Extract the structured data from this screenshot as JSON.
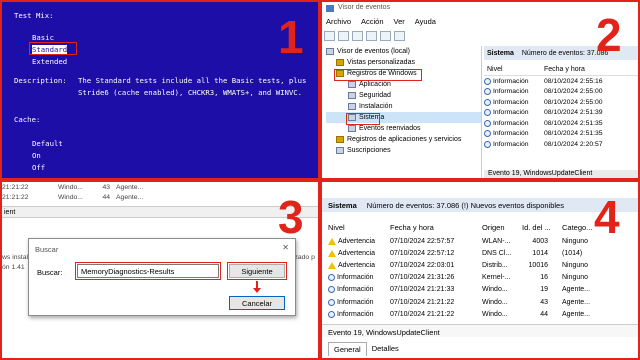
{
  "panel1": {
    "number": "1",
    "test_mix_label": "Test Mix:",
    "options": [
      "Basic",
      "Standard",
      "Extended"
    ],
    "description_label": "Description:",
    "description_line1": "The Standard tests include all the Basic tests, plus",
    "description_line2": "Stride6 (cache enabled), CHCKR3, WMATS+, and WINVC.",
    "cache_label": "Cache:",
    "cache_options": [
      "Default",
      "On",
      "Off"
    ]
  },
  "panel2": {
    "number": "2",
    "window_title": "Visor de eventos",
    "menu": [
      "Archivo",
      "Acción",
      "Ver",
      "Ayuda"
    ],
    "tree": {
      "root": "Visor de eventos (local)",
      "custom_views": "Vistas personalizadas",
      "windows_logs": "Registros de Windows",
      "logs": [
        "Aplicación",
        "Seguridad",
        "Instalación",
        "Sistema",
        "Eventos reenviados"
      ],
      "apps_services": "Registros de aplicaciones y servicios",
      "subscriptions": "Suscripciones"
    },
    "list_header": {
      "name": "Sistema",
      "count": "Número de eventos: 37.086"
    },
    "columns": [
      "Nivel",
      "Fecha y hora"
    ],
    "rows": [
      {
        "level": "Información",
        "date": "08/10/2024 2:55:16"
      },
      {
        "level": "Información",
        "date": "08/10/2024 2:55:00"
      },
      {
        "level": "Información",
        "date": "08/10/2024 2:55:00"
      },
      {
        "level": "Información",
        "date": "08/10/2024 2:51:39"
      },
      {
        "level": "Información",
        "date": "08/10/2024 2:51:35"
      },
      {
        "level": "Información",
        "date": "08/10/2024 2:51:35"
      },
      {
        "level": "Información",
        "date": "08/10/2024 2:20:57"
      }
    ],
    "footer": "Evento 19, WindowsUpdateClient"
  },
  "panel3": {
    "number": "3",
    "bg_rows": [
      {
        "time": "21:21:22",
        "source": "Windo...",
        "id": "43",
        "cat": "Agente..."
      },
      {
        "time": "21:21:22",
        "source": "Windo...",
        "id": "44",
        "cat": "Agente..."
      }
    ],
    "bg_label": "ient",
    "bg_text1": "ws instal",
    "bg_text2": "ón 1.41",
    "bg_right1": "tualizado p",
    "dialog_title": "Buscar",
    "search_label": "Buscar:",
    "search_value": "MemoryDiagnostics-Results",
    "next_button": "Siguiente",
    "cancel_button": "Cancelar",
    "close_glyph": "✕"
  },
  "panel4": {
    "number": "4",
    "header_name": "Sistema",
    "header_count": "Número de eventos: 37.086 (!) Nuevos eventos disponibles",
    "columns": [
      "Nivel",
      "Fecha y hora",
      "Origen",
      "Id. del ...",
      "Catego..."
    ],
    "rows": [
      {
        "level": "Advertencia",
        "icon": "warn",
        "date": "07/10/2024 22:57:57",
        "source": "WLAN-...",
        "id": "4003",
        "cat": "Ninguno"
      },
      {
        "level": "Advertencia",
        "icon": "warn",
        "date": "07/10/2024 22:57:12",
        "source": "DNS Cl...",
        "id": "1014",
        "cat": "(1014)"
      },
      {
        "level": "Advertencia",
        "icon": "warn",
        "date": "07/10/2024 22:03:01",
        "source": "Distrib...",
        "id": "10016",
        "cat": "Ninguno"
      },
      {
        "level": "Información",
        "icon": "info",
        "date": "07/10/2024 21:31:26",
        "source": "Kernel-...",
        "id": "16",
        "cat": "Ninguno"
      },
      {
        "level": "Información",
        "icon": "info",
        "date": "07/10/2024 21:21:33",
        "source": "Windo...",
        "id": "19",
        "cat": "Agente..."
      },
      {
        "level": "Información",
        "icon": "info",
        "date": "07/10/2024 21:21:22",
        "source": "Windo...",
        "id": "43",
        "cat": "Agente..."
      },
      {
        "level": "Información",
        "icon": "info",
        "date": "07/10/2024 21:21:22",
        "source": "Windo...",
        "id": "44",
        "cat": "Agente..."
      }
    ],
    "event_title": "Evento 19, WindowsUpdateClient",
    "tabs": [
      "General",
      "Detalles"
    ]
  }
}
